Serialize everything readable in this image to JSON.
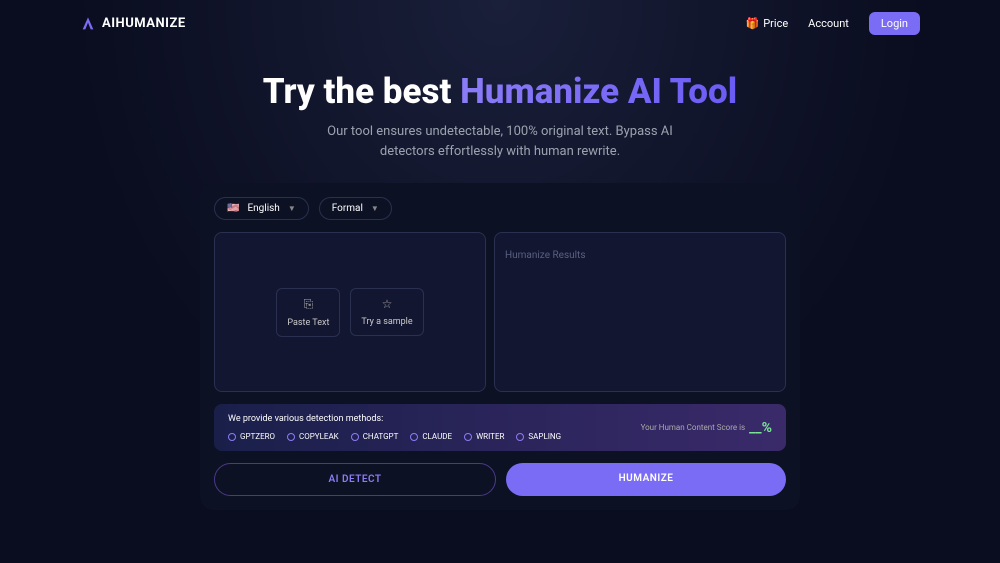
{
  "header": {
    "logo_text": "AIHUMANIZE",
    "nav": {
      "price": "Price",
      "price_icon": "🎁",
      "account": "Account",
      "login": "Login"
    }
  },
  "hero": {
    "title_part1": "Try the best ",
    "title_part2": "Humanize AI Tool",
    "subtitle_line1": "Our tool ensures undetectable, 100% original text. Bypass AI",
    "subtitle_line2": "detectors effortlessly with human rewrite."
  },
  "selectors": {
    "language": {
      "flag": "🇺🇸",
      "value": "English"
    },
    "tone": {
      "value": "Formal"
    }
  },
  "panels": {
    "paste_text": "Paste Text",
    "try_sample": "Try a sample",
    "results_placeholder": "Humanize Results"
  },
  "detection": {
    "title": "We provide various detection methods:",
    "methods": [
      "GPTZERO",
      "COPYLEAK",
      "CHATGPT",
      "CLAUDE",
      "WRITER",
      "SAPLING"
    ],
    "score_label": "Your Human Content Score is",
    "score_value": "__",
    "score_unit": "%"
  },
  "actions": {
    "detect": "AI DETECT",
    "humanize": "HUMANIZE"
  }
}
